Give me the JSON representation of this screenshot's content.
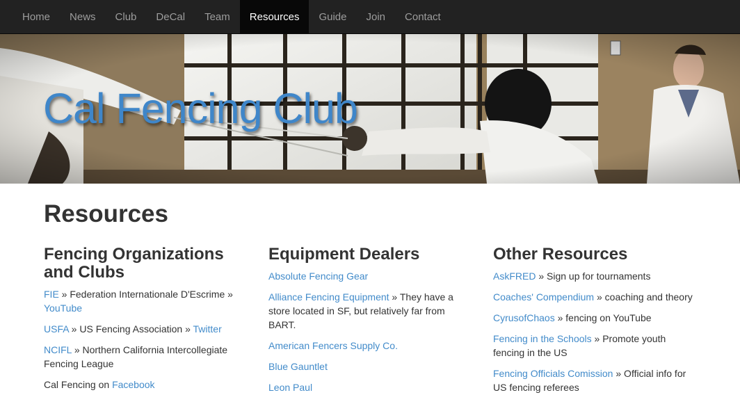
{
  "nav": {
    "items": [
      "Home",
      "News",
      "Club",
      "DeCal",
      "Team",
      "Resources",
      "Guide",
      "Join",
      "Contact"
    ],
    "active": "Resources"
  },
  "hero": {
    "title": "Cal Fencing Club"
  },
  "page": {
    "title": "Resources"
  },
  "columns": [
    {
      "heading": "Fencing Organizations and Clubs",
      "entries": [
        {
          "link": "FIE",
          "text": " » Federation Internationale D'Escrime » ",
          "link2": "YouTube"
        },
        {
          "link": "USFA",
          "text": " » US Fencing Association » ",
          "link2": "Twitter"
        },
        {
          "link": "NCIFL",
          "text": " » Northern California Intercollegiate Fencing League"
        },
        {
          "prefix": "Cal Fencing on ",
          "link": "Facebook"
        }
      ]
    },
    {
      "heading": "Equipment Dealers",
      "entries": [
        {
          "link": "Absolute Fencing Gear"
        },
        {
          "link": "Alliance Fencing Equipment",
          "text": " » They have a store located in SF, but relatively far from BART."
        },
        {
          "link": "American Fencers Supply Co."
        },
        {
          "link": "Blue Gauntlet"
        },
        {
          "link": "Leon Paul"
        }
      ]
    },
    {
      "heading": "Other Resources",
      "entries": [
        {
          "link": "AskFRED",
          "text": " » Sign up for tournaments"
        },
        {
          "link": "Coaches' Compendium",
          "text": " » coaching and theory"
        },
        {
          "link": "CyrusofChaos",
          "text": " » fencing on YouTube"
        },
        {
          "link": "Fencing in the Schools",
          "text": " » Promote youth fencing in the US"
        },
        {
          "link": "Fencing Officials Comission",
          "text": " » Official info for US fencing referees"
        }
      ]
    }
  ],
  "colors": {
    "navbar": "#222222",
    "link": "#428bca",
    "hero_title": "#3f86c9",
    "text": "#333333"
  }
}
